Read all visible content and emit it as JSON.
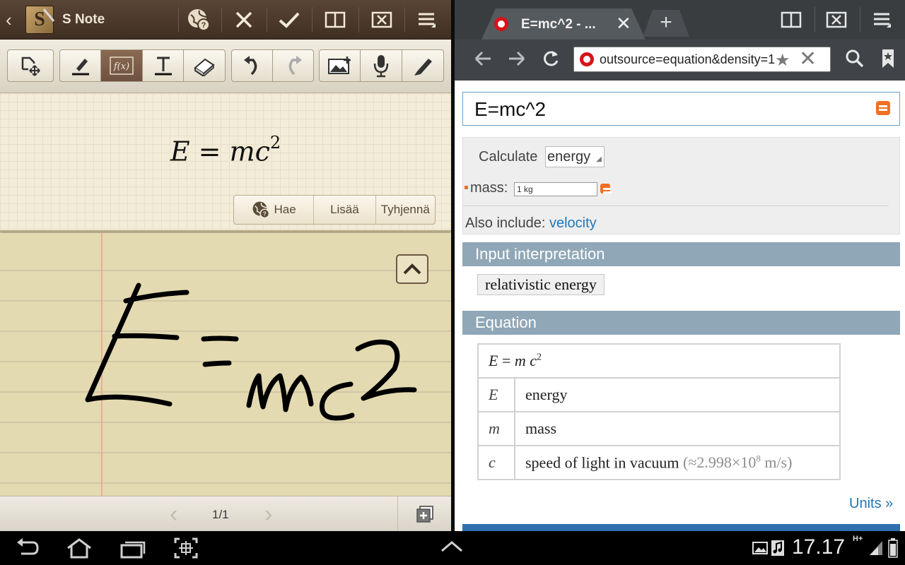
{
  "snote": {
    "app_name": "S Note",
    "title_icons": [
      "back-icon",
      "app-logo-icon",
      "web-search-icon",
      "close-icon",
      "check-icon",
      "split-view-icon",
      "exit-split-icon",
      "menu-icon"
    ],
    "tools": [
      "page-select-icon",
      "pen-icon",
      "formula-match-icon",
      "text-icon",
      "eraser-icon",
      "undo-icon",
      "redo-icon",
      "insert-image-icon",
      "voice-icon",
      "brush-icon"
    ],
    "formula": {
      "base": "E = mc",
      "exponent": "2"
    },
    "actions": {
      "search": "Hae",
      "insert": "Lisää",
      "clear": "Tyhjennä"
    },
    "handwriting_text": "E=mc2",
    "pager": "1/1"
  },
  "browser": {
    "tab_title": "E=mc^2 - ...",
    "url": "outsource=equation&density=1",
    "newtab_label": "+",
    "wolfram": {
      "query": "E=mc^2",
      "calculate_label": "Calculate",
      "calculate_value": "energy",
      "mass_label": "mass:",
      "mass_value": "1 kg",
      "also_label": "Also include:",
      "also_link": "velocity",
      "pods": {
        "input_title": "Input interpretation",
        "input_value": "relativistic energy",
        "equation_title": "Equation"
      },
      "equation": {
        "lhs": "E",
        "mid": " = ",
        "m": "m",
        "c": "c",
        "exp": "2"
      },
      "table": [
        {
          "symbol": "E",
          "meaning": "energy",
          "note": ""
        },
        {
          "symbol": "m",
          "meaning": "mass",
          "note": ""
        },
        {
          "symbol": "c",
          "meaning": "speed of light in vacuum",
          "note": "(≈2.998×10",
          "note_exp": "8",
          "note_unit": " m/s)"
        }
      ],
      "units_link": "Units »"
    }
  },
  "system": {
    "clock": "17.17",
    "network": "H+"
  },
  "colors": {
    "snote_paper": "#e4dab1",
    "wolfram_pod": "#8fa7b7",
    "link": "#1f76b8",
    "accent_orange": "#f26e22"
  }
}
